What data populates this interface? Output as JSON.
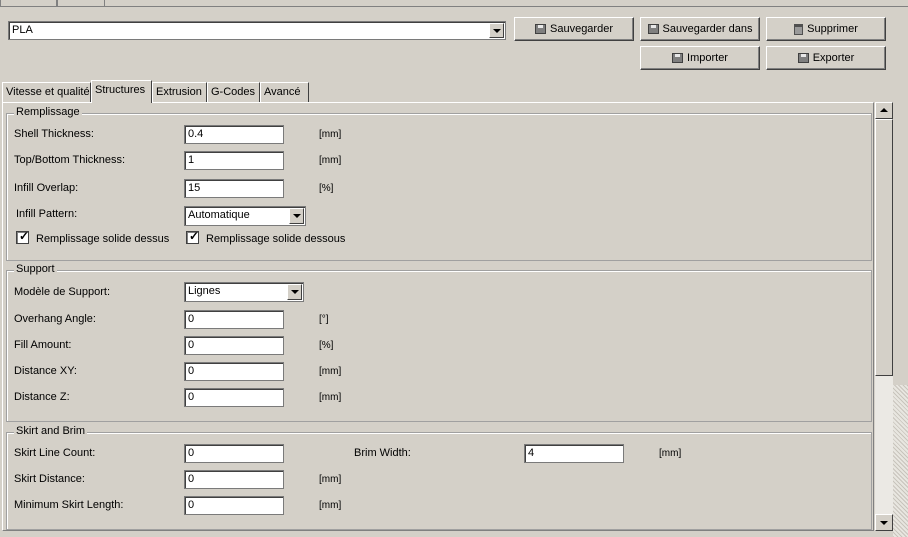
{
  "profile": {
    "selected": "PLA"
  },
  "buttons": {
    "save": "Sauvegarder",
    "save_in": "Sauvegarder dans",
    "delete": "Supprimer",
    "import": "Importer",
    "export": "Exporter"
  },
  "tabs": [
    {
      "label": "Vitesse et qualité"
    },
    {
      "label": "Structures"
    },
    {
      "label": "Extrusion"
    },
    {
      "label": "G-Codes"
    },
    {
      "label": "Avancé"
    }
  ],
  "fill": {
    "title": "Remplissage",
    "shell_thickness": {
      "label": "Shell Thickness:",
      "value": "0.4",
      "unit": "[mm]"
    },
    "top_bottom": {
      "label": "Top/Bottom Thickness:",
      "value": "1",
      "unit": "[mm]"
    },
    "infill_overlap": {
      "label": "Infill Overlap:",
      "value": "15",
      "unit": "[%]"
    },
    "infill_pattern": {
      "label": "Infill Pattern:",
      "value": "Automatique"
    },
    "solid_top": {
      "label": "Remplissage solide dessus",
      "checked": true
    },
    "solid_bottom": {
      "label": "Remplissage solide dessous",
      "checked": true
    }
  },
  "support": {
    "title": "Support",
    "model": {
      "label": "Modèle de Support:",
      "value": "Lignes"
    },
    "overhang": {
      "label": "Overhang Angle:",
      "value": "0",
      "unit": "[°]"
    },
    "fill_amount": {
      "label": "Fill Amount:",
      "value": "0",
      "unit": "[%]"
    },
    "distance_xy": {
      "label": "Distance XY:",
      "value": "0",
      "unit": "[mm]"
    },
    "distance_z": {
      "label": "Distance Z:",
      "value": "0",
      "unit": "[mm]"
    }
  },
  "skirt": {
    "title": "Skirt and Brim",
    "line_count": {
      "label": "Skirt Line Count:",
      "value": "0"
    },
    "brim_width": {
      "label": "Brim Width:",
      "value": "4",
      "unit": "[mm]"
    },
    "distance": {
      "label": "Skirt Distance:",
      "value": "0",
      "unit": "[mm]"
    },
    "min_length": {
      "label": "Minimum Skirt Length:",
      "value": "0",
      "unit": "[mm]"
    }
  }
}
